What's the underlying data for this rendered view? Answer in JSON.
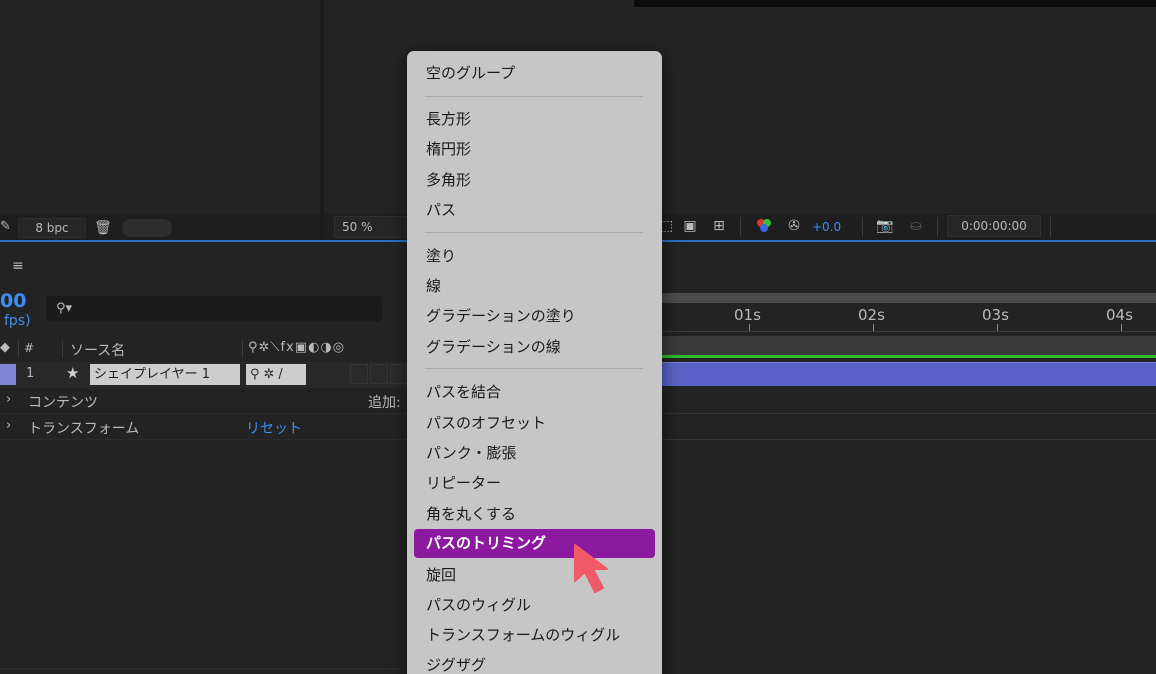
{
  "project": {
    "bpc": "8 bpc"
  },
  "viewer": {
    "zoom": "50 %",
    "exposure": "+0.0",
    "timecode": "0:00:00:00"
  },
  "timeline": {
    "timecode": "00",
    "fps": "fps)",
    "columns": {
      "num": "#",
      "source_name": "ソース名",
      "switches": "⚲✲⟍fx▣◐◑◎"
    },
    "layer": {
      "index": "1",
      "name": "シェイプレイヤー 1",
      "switches": "⚲✲/"
    },
    "properties": [
      {
        "label": "コンテンツ",
        "action": "追加:"
      },
      {
        "label": "トランスフォーム",
        "action": "リセット"
      }
    ],
    "ruler": [
      "01s",
      "02s",
      "03s",
      "04s"
    ]
  },
  "menu": {
    "groups": [
      [
        "空のグループ"
      ],
      [
        "長方形",
        "楕円形",
        "多角形",
        "パス"
      ],
      [
        "塗り",
        "線",
        "グラデーションの塗り",
        "グラデーションの線"
      ],
      [
        "パスを結合",
        "パスのオフセット",
        "パンク・膨張",
        "リピーター",
        "角を丸くする",
        "パスのトリミング",
        "旋回",
        "パスのウィグル",
        "トランスフォームのウィグル",
        "ジグザグ"
      ]
    ],
    "highlighted": "パスのトリミング"
  },
  "colors": {
    "accent_blue": "#3d8ef0",
    "menu_highlight": "#8c1aa0",
    "layer_label": "#8185d6",
    "cursor": "#f05a68"
  }
}
